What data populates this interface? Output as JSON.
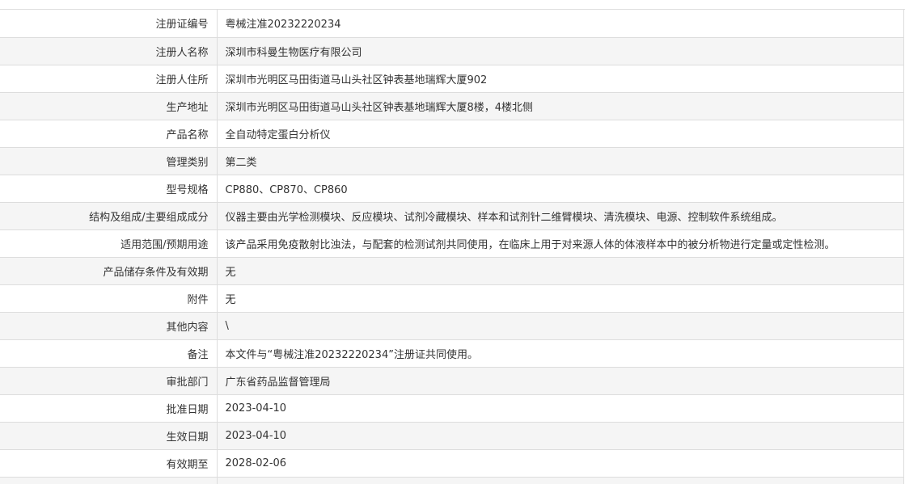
{
  "rows": [
    {
      "label": "注册证编号",
      "value": "粤械注准20232220234"
    },
    {
      "label": "注册人名称",
      "value": "深圳市科曼生物医疗有限公司"
    },
    {
      "label": "注册人住所",
      "value": "深圳市光明区马田街道马山头社区钟表基地瑞辉大厦902"
    },
    {
      "label": "生产地址",
      "value": "深圳市光明区马田街道马山头社区钟表基地瑞辉大厦8楼，4楼北侧"
    },
    {
      "label": "产品名称",
      "value": "全自动特定蛋白分析仪"
    },
    {
      "label": "管理类别",
      "value": "第二类"
    },
    {
      "label": "型号规格",
      "value": "CP880、CP870、CP860"
    },
    {
      "label": "结构及组成/主要组成成分",
      "value": "仪器主要由光学检测模块、反应模块、试剂冷藏模块、样本和试剂针二维臂模块、清洗模块、电源、控制软件系统组成。"
    },
    {
      "label": "适用范围/预期用途",
      "value": "该产品采用免疫散射比浊法，与配套的检测试剂共同使用，在临床上用于对来源人体的体液样本中的被分析物进行定量或定性检测。"
    },
    {
      "label": "产品储存条件及有效期",
      "value": "无"
    },
    {
      "label": "附件",
      "value": "无"
    },
    {
      "label": "其他内容",
      "value": "\\"
    },
    {
      "label": "备注",
      "value": "本文件与“粤械注准20232220234”注册证共同使用。"
    },
    {
      "label": "审批部门",
      "value": "广东省药品监督管理局"
    },
    {
      "label": "批准日期",
      "value": "2023-04-10"
    },
    {
      "label": "生效日期",
      "value": "2023-04-10"
    },
    {
      "label": "有效期至",
      "value": "2028-02-06"
    },
    {
      "label": "",
      "value": ""
    }
  ]
}
